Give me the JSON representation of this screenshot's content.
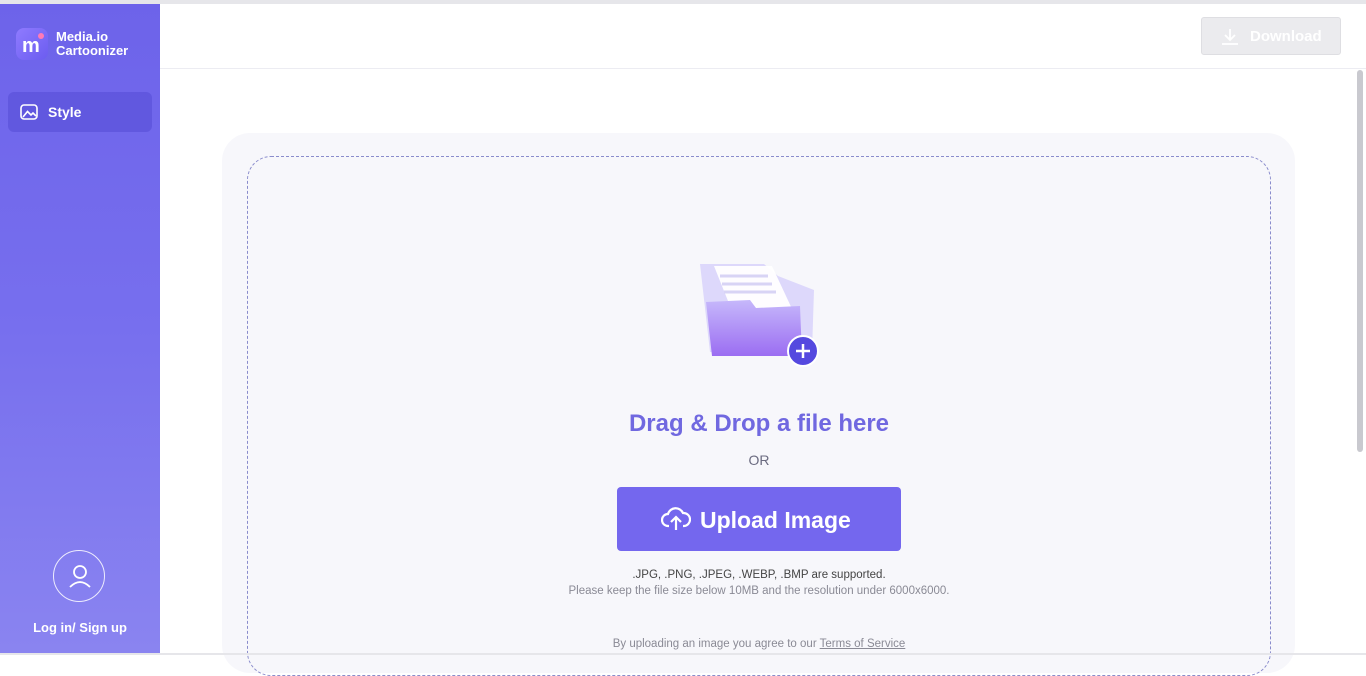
{
  "app": {
    "name_line1": "Media.io",
    "name_line2": "Cartoonizer"
  },
  "sidebar": {
    "style_label": "Style",
    "login_label": "Log in/ Sign up"
  },
  "header": {
    "download_label": "Download"
  },
  "upload": {
    "drag_title": "Drag & Drop a file here",
    "or_text": "OR",
    "button_label": "Upload Image",
    "formats": ".JPG, .PNG, .JPEG, .WEBP, .BMP are supported.",
    "limits": "Please keep the file size below 10MB and the resolution under 6000x6000.",
    "terms_prefix": "By uploading an image you agree to our",
    "terms_link": "Terms of Service"
  },
  "colors": {
    "accent": "#7467ee",
    "sidebar": "#6d63ea",
    "title": "#7068e0"
  },
  "icons": [
    "media-io-logo-icon",
    "image-icon",
    "user-icon",
    "download-icon",
    "folder-icon",
    "plus-icon",
    "cloud-upload-icon"
  ]
}
